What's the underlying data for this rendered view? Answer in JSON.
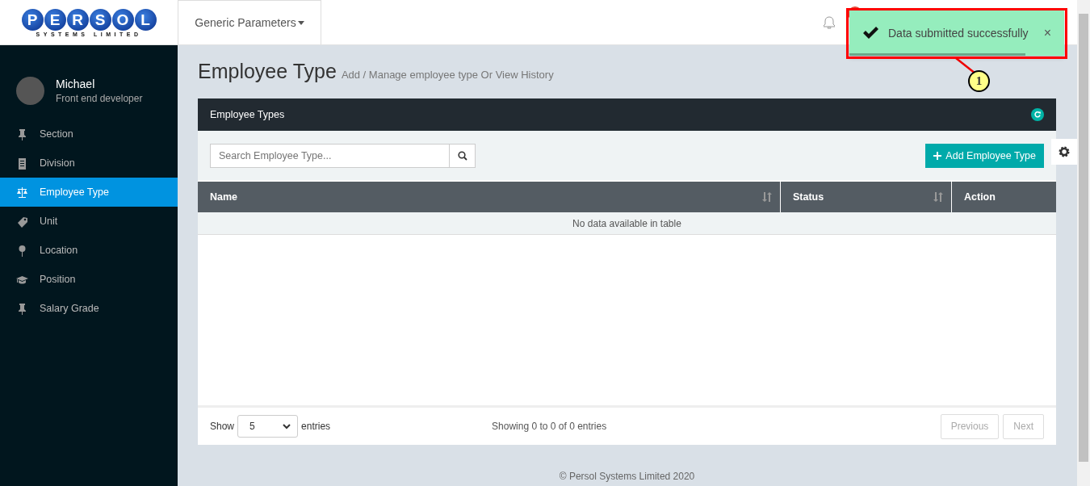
{
  "header": {
    "logo": {
      "letters": [
        "P",
        "E",
        "R",
        "S",
        "O",
        "L"
      ],
      "tagline": "SYSTEMS LIMITED"
    },
    "menu": "Generic Parameters"
  },
  "toast": {
    "message": "Data submitted successfully",
    "close": "×",
    "level": 0.82
  },
  "callout": {
    "number": "1"
  },
  "profile": {
    "name": "Michael",
    "role": "Front end developer"
  },
  "sidebar": {
    "items": [
      {
        "label": "Section",
        "selected": false
      },
      {
        "label": "Division",
        "selected": false
      },
      {
        "label": "Employee Type",
        "selected": true
      },
      {
        "label": "Unit",
        "selected": false
      },
      {
        "label": "Location",
        "selected": false
      },
      {
        "label": "Position",
        "selected": false
      },
      {
        "label": "Salary Grade",
        "selected": false
      }
    ]
  },
  "page": {
    "title": "Employee Type",
    "subtitle": "Add / Manage employee type Or View History"
  },
  "panel": {
    "title": "Employee Types",
    "search": {
      "placeholder": "Search Employee Type..."
    },
    "add_button": "Add Employee Type",
    "table": {
      "columns": [
        {
          "label": "Name",
          "sortable": true
        },
        {
          "label": "Status",
          "sortable": true
        },
        {
          "label": "Action",
          "sortable": false
        }
      ],
      "empty_message": "No data available in table"
    },
    "footer": {
      "show": "Show",
      "page_size": "5",
      "entries": "entries",
      "info": "Showing 0 to 0 of 0 entries",
      "buttons": [
        {
          "label": "Previous",
          "disabled": true
        },
        {
          "label": "Next",
          "disabled": true
        }
      ]
    }
  },
  "footer": "© Persol Systems Limited 2020"
}
